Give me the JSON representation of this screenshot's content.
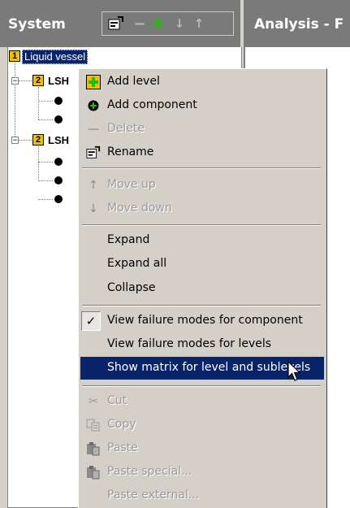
{
  "header": {
    "system_title": "System",
    "analysis_title": "Analysis - F"
  },
  "toolbar": {
    "rename_icon": "rename-icon",
    "minus_icon": "minus-icon",
    "plus_icon": "plus-icon",
    "down_icon": "arrow-down-icon",
    "up_icon": "arrow-up-icon"
  },
  "tree": {
    "root": {
      "level": "1",
      "label": "Liquid vessel"
    },
    "nodes": [
      {
        "level": "2",
        "label": "LSH"
      },
      {
        "level": "2",
        "label": "LSH"
      }
    ]
  },
  "menu": {
    "items": [
      {
        "label": "Add level",
        "icon": "add-level-icon",
        "disabled": false
      },
      {
        "label": "Add component",
        "icon": "add-component-icon",
        "disabled": false
      },
      {
        "label": "Delete",
        "icon": "delete-icon",
        "disabled": true
      },
      {
        "label": "Rename",
        "icon": "rename-icon",
        "disabled": false
      },
      {
        "label": "Move up",
        "icon": "arrow-up-icon",
        "disabled": true
      },
      {
        "label": "Move down",
        "icon": "arrow-down-icon",
        "disabled": true
      },
      {
        "label": "Expand",
        "disabled": false
      },
      {
        "label": "Expand all",
        "disabled": false
      },
      {
        "label": "Collapse",
        "disabled": false
      },
      {
        "label": "View failure modes for component",
        "checked": true,
        "disabled": false
      },
      {
        "label": "View failure modes for levels",
        "disabled": false
      },
      {
        "label": "Show matrix for level and sublevels",
        "highlighted": true,
        "disabled": false
      },
      {
        "label": "Cut",
        "icon": "cut-icon",
        "disabled": true
      },
      {
        "label": "Copy",
        "icon": "copy-icon",
        "disabled": true
      },
      {
        "label": "Paste",
        "icon": "paste-icon",
        "disabled": true
      },
      {
        "label": "Paste special...",
        "icon": "paste-special-icon",
        "disabled": true
      },
      {
        "label": "Paste external...",
        "disabled": true
      }
    ]
  },
  "colors": {
    "header_bg": "#7a7a7a",
    "selection": "#0a246a",
    "badge": "#f0c000",
    "add_green": "#00a000"
  }
}
